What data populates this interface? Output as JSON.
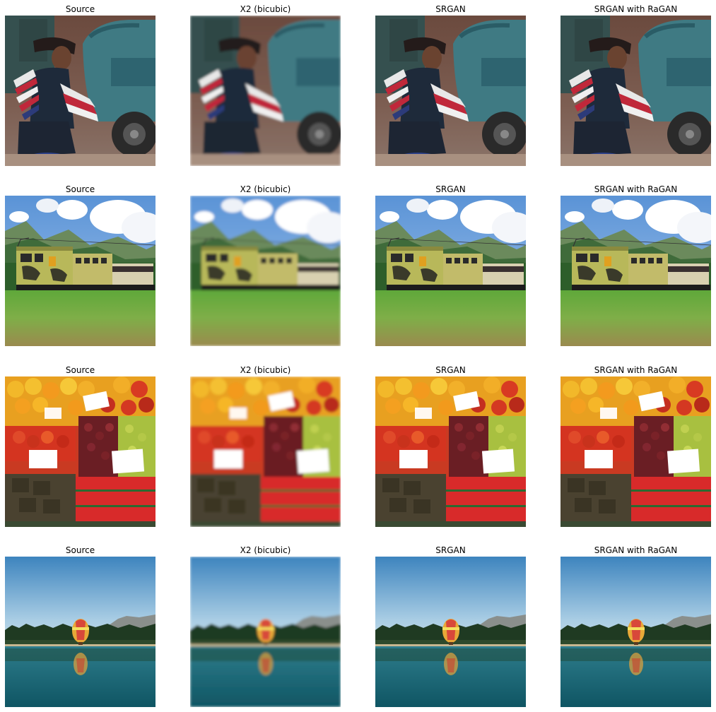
{
  "grid": {
    "column_titles": [
      "Source",
      "X2 (bicubic)",
      "SRGAN",
      "SRGAN with RaGAN"
    ],
    "rows": [
      {
        "subject": "mechanic",
        "cells": [
          {
            "title": "Source",
            "sharpness": "sharp"
          },
          {
            "title": "X2 (bicubic)",
            "sharpness": "blurred"
          },
          {
            "title": "SRGAN",
            "sharpness": "sharp"
          },
          {
            "title": "SRGAN with RaGAN",
            "sharpness": "sharp"
          }
        ]
      },
      {
        "subject": "train",
        "cells": [
          {
            "title": "Source",
            "sharpness": "sharp"
          },
          {
            "title": "X2 (bicubic)",
            "sharpness": "blurred"
          },
          {
            "title": "SRGAN",
            "sharpness": "sharp"
          },
          {
            "title": "SRGAN with RaGAN",
            "sharpness": "sharp"
          }
        ]
      },
      {
        "subject": "fruit",
        "cells": [
          {
            "title": "Source",
            "sharpness": "sharp"
          },
          {
            "title": "X2 (bicubic)",
            "sharpness": "blurred"
          },
          {
            "title": "SRGAN",
            "sharpness": "sharp"
          },
          {
            "title": "SRGAN with RaGAN",
            "sharpness": "sharp"
          }
        ]
      },
      {
        "subject": "balloon",
        "cells": [
          {
            "title": "Source",
            "sharpness": "sharp"
          },
          {
            "title": "X2 (bicubic)",
            "sharpness": "blurred"
          },
          {
            "title": "SRGAN",
            "sharpness": "sharp"
          },
          {
            "title": "SRGAN with RaGAN",
            "sharpness": "sharp"
          }
        ]
      }
    ]
  }
}
